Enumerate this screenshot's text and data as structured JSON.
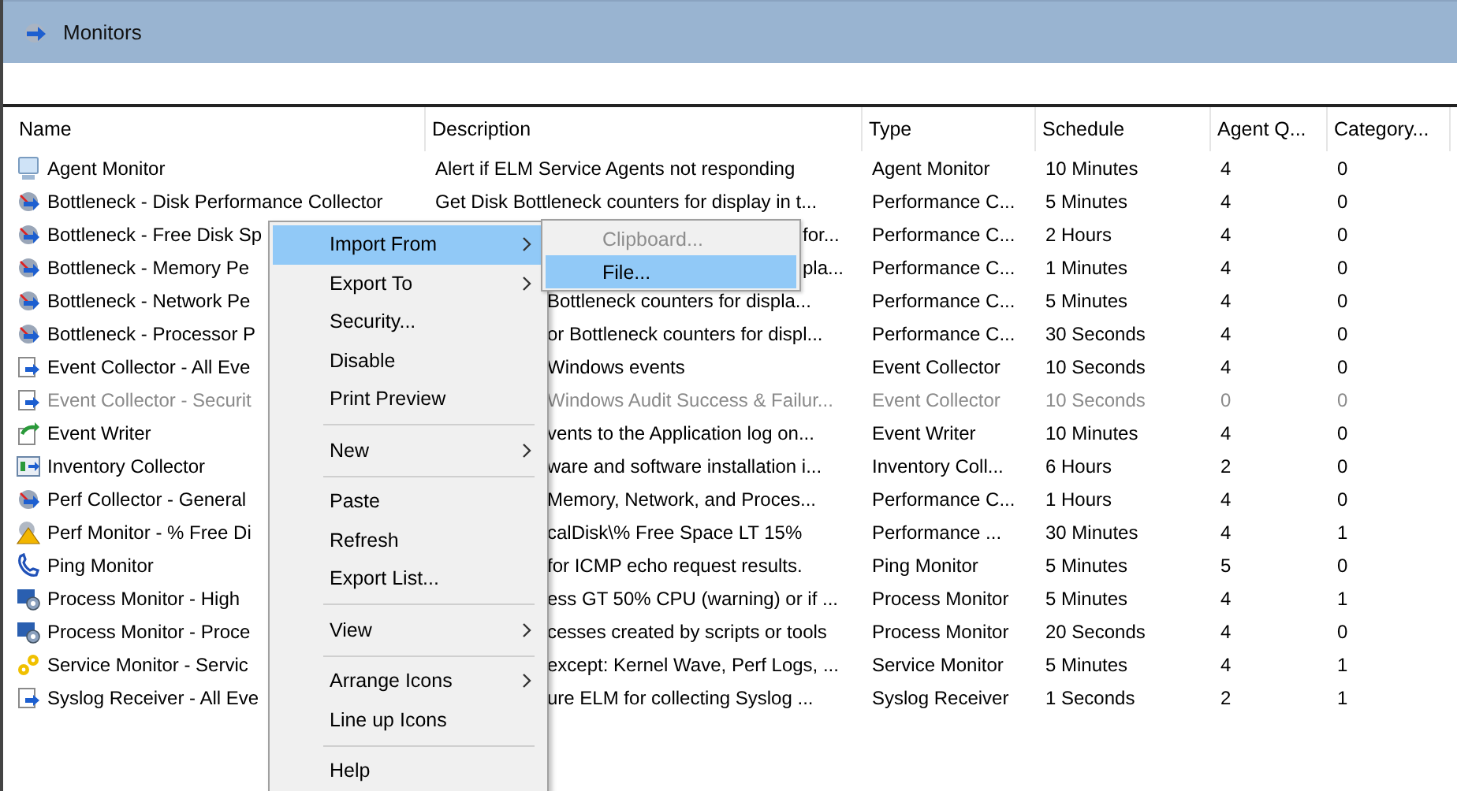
{
  "window": {
    "title": "Monitors"
  },
  "table": {
    "columns": [
      "Name",
      "Description",
      "Type",
      "Schedule",
      "Agent Q...",
      "Category..."
    ],
    "rows": [
      {
        "name": "Agent Monitor",
        "description": "Alert if ELM Service Agents not responding",
        "type": "Agent Monitor",
        "schedule": "10 Minutes",
        "agent": "4",
        "category": "0",
        "disabled": false
      },
      {
        "name": "Bottleneck - Disk Performance Collector",
        "description": "Get Disk Bottleneck counters for display in t...",
        "type": "Performance C...",
        "schedule": "5 Minutes",
        "agent": "4",
        "category": "0",
        "disabled": false
      },
      {
        "name": "Bottleneck - Free Disk Sp",
        "description": "for...",
        "type": "Performance C...",
        "schedule": "2 Hours",
        "agent": "4",
        "category": "0",
        "disabled": false
      },
      {
        "name": "Bottleneck - Memory Pe",
        "description": "pla...",
        "type": "Performance C...",
        "schedule": "1 Minutes",
        "agent": "4",
        "category": "0",
        "disabled": false
      },
      {
        "name": "Bottleneck - Network Pe",
        "description": "Bottleneck counters for displa...",
        "type": "Performance C...",
        "schedule": "5 Minutes",
        "agent": "4",
        "category": "0",
        "disabled": false
      },
      {
        "name": "Bottleneck - Processor P",
        "description": "or Bottleneck counters for displ...",
        "type": "Performance C...",
        "schedule": "30 Seconds",
        "agent": "4",
        "category": "0",
        "disabled": false
      },
      {
        "name": "Event Collector - All Eve",
        "description": "Windows events",
        "type": "Event Collector",
        "schedule": "10 Seconds",
        "agent": "4",
        "category": "0",
        "disabled": false
      },
      {
        "name": "Event Collector - Securit",
        "description": "Windows Audit Success & Failur...",
        "type": "Event Collector",
        "schedule": "10 Seconds",
        "agent": "0",
        "category": "0",
        "disabled": true
      },
      {
        "name": "Event Writer",
        "description": "vents to the Application log on...",
        "type": "Event Writer",
        "schedule": "10 Minutes",
        "agent": "4",
        "category": "0",
        "disabled": false
      },
      {
        "name": "Inventory Collector",
        "description": "ware and software installation i...",
        "type": "Inventory Coll...",
        "schedule": "6 Hours",
        "agent": "2",
        "category": "0",
        "disabled": false
      },
      {
        "name": "Perf Collector - General",
        "description": "Memory, Network, and Proces...",
        "type": "Performance C...",
        "schedule": "1 Hours",
        "agent": "4",
        "category": "0",
        "disabled": false
      },
      {
        "name": "Perf Monitor - % Free Di",
        "description": "calDisk\\% Free Space LT 15%",
        "type": "Performance ...",
        "schedule": "30 Minutes",
        "agent": "4",
        "category": "1",
        "disabled": false
      },
      {
        "name": "Ping Monitor",
        "description": "for ICMP echo request results.",
        "type": "Ping Monitor",
        "schedule": "5 Minutes",
        "agent": "5",
        "category": "0",
        "disabled": false
      },
      {
        "name": "Process Monitor - High",
        "description": "ess GT 50% CPU (warning) or if ...",
        "type": "Process Monitor",
        "schedule": "5 Minutes",
        "agent": "4",
        "category": "1",
        "disabled": false
      },
      {
        "name": "Process Monitor - Proce",
        "description": "cesses created by scripts or tools",
        "type": "Process Monitor",
        "schedule": "20 Seconds",
        "agent": "4",
        "category": "0",
        "disabled": false
      },
      {
        "name": "Service Monitor - Servic",
        "description": "except: Kernel Wave, Perf Logs, ...",
        "type": "Service Monitor",
        "schedule": "5 Minutes",
        "agent": "4",
        "category": "1",
        "disabled": false
      },
      {
        "name": "Syslog Receiver - All Eve",
        "description": "ure ELM for collecting Syslog ...",
        "type": "Syslog Receiver",
        "schedule": "1 Seconds",
        "agent": "2",
        "category": "1",
        "disabled": false
      }
    ]
  },
  "context_menu": {
    "items": [
      {
        "kind": "item",
        "label": "Import From",
        "submenu": true,
        "selected": true
      },
      {
        "kind": "item",
        "label": "Export To",
        "submenu": true,
        "selected": false
      },
      {
        "kind": "item",
        "label": "Security...",
        "submenu": false,
        "selected": false
      },
      {
        "kind": "item",
        "label": "Disable",
        "submenu": false,
        "selected": false
      },
      {
        "kind": "item",
        "label": "Print Preview",
        "submenu": false,
        "selected": false
      },
      {
        "kind": "separator"
      },
      {
        "kind": "item",
        "label": "New",
        "submenu": true,
        "selected": false
      },
      {
        "kind": "separator"
      },
      {
        "kind": "item",
        "label": "Paste",
        "submenu": false,
        "selected": false
      },
      {
        "kind": "item",
        "label": "Refresh",
        "submenu": false,
        "selected": false
      },
      {
        "kind": "item",
        "label": "Export List...",
        "submenu": false,
        "selected": false
      },
      {
        "kind": "separator"
      },
      {
        "kind": "item",
        "label": "View",
        "submenu": true,
        "selected": false
      },
      {
        "kind": "separator"
      },
      {
        "kind": "item",
        "label": "Arrange Icons",
        "submenu": true,
        "selected": false
      },
      {
        "kind": "item",
        "label": "Line up Icons",
        "submenu": false,
        "selected": false
      },
      {
        "kind": "separator"
      },
      {
        "kind": "item",
        "label": "Help",
        "submenu": false,
        "selected": false
      }
    ]
  },
  "submenu": {
    "items": [
      {
        "label": "Clipboard...",
        "disabled": true,
        "selected": false
      },
      {
        "label": "File...",
        "disabled": false,
        "selected": true
      }
    ]
  }
}
